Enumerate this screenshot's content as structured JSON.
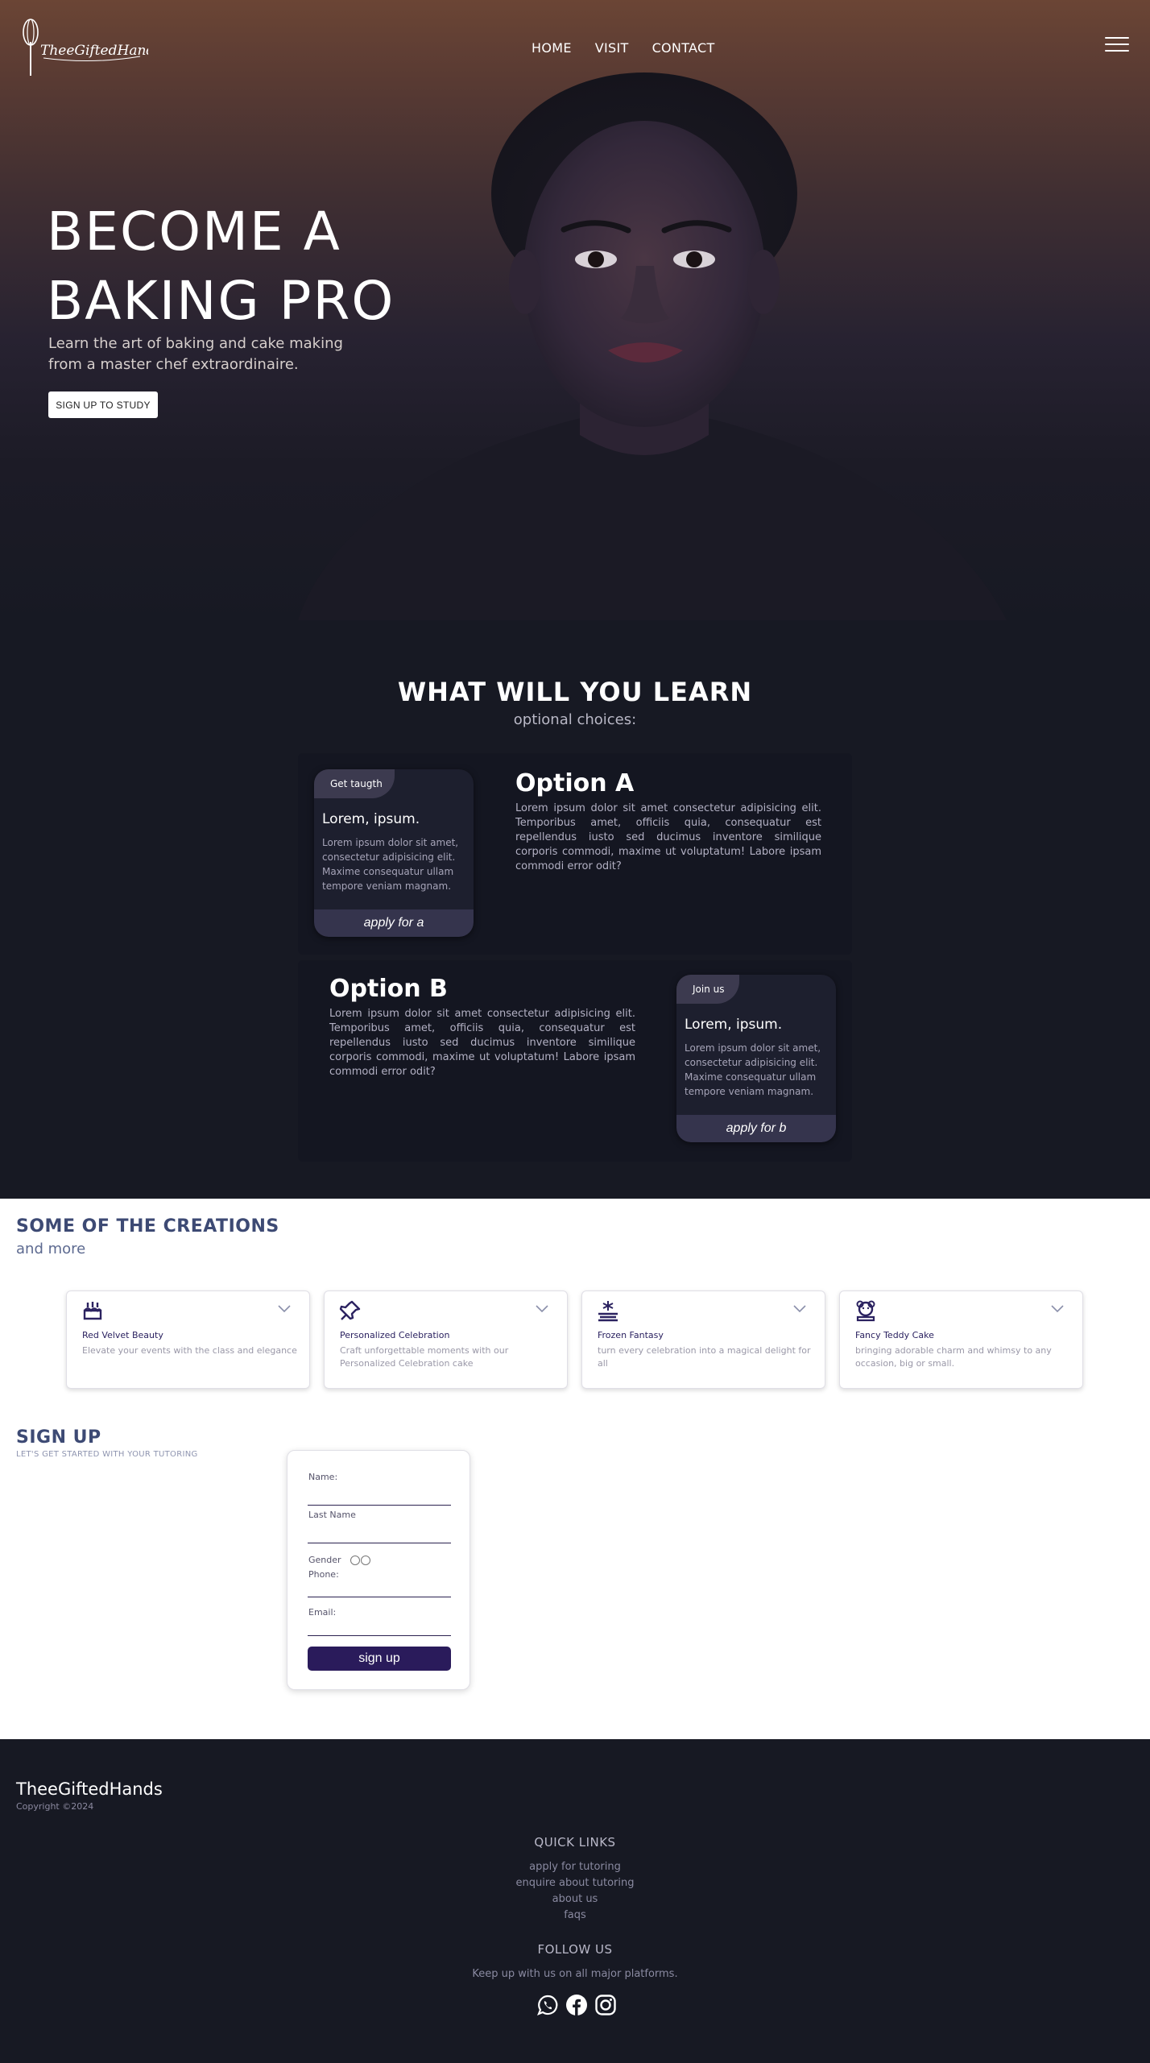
{
  "nav": {
    "logo_text": "TheeGiftedHands",
    "links": [
      "HOME",
      "VISIT",
      "CONTACT"
    ]
  },
  "hero": {
    "title_line1": "BECOME A",
    "title_line2": "BAKING PRO",
    "subtitle": "Learn the art of baking and cake making from a master chef extraordinaire.",
    "cta": "SIGN UP TO STUDY"
  },
  "learn": {
    "title": "WHAT WILL YOU LEARN",
    "subtitle": "optional choices:",
    "options": [
      {
        "card_tag": "Get taugth",
        "card_title": "Lorem, ipsum.",
        "card_text": "Lorem ipsum dolor sit amet, consectetur adipisicing elit. Maxime consequatur ullam tempore veniam magnam.",
        "card_button": "apply for a",
        "heading": "Option A",
        "text": "Lorem ipsum dolor sit amet consectetur adipisicing elit. Temporibus amet, officiis quia, consequatur est repellendus iusto sed ducimus inventore similique corporis commodi, maxime ut voluptatum! Labore ipsam commodi error odit?"
      },
      {
        "card_tag": "Join us",
        "card_title": "Lorem, ipsum.",
        "card_text": "Lorem ipsum dolor sit amet, consectetur adipisicing elit. Maxime consequatur ullam tempore veniam magnam.",
        "card_button": "apply for b",
        "heading": "Option B",
        "text": "Lorem ipsum dolor sit amet consectetur adipisicing elit. Temporibus amet, officiis quia, consequatur est repellendus iusto sed ducimus inventore similique corporis commodi, maxime ut voluptatum! Labore ipsam commodi error odit?"
      }
    ]
  },
  "creations": {
    "title": "SOME OF THE CREATIONS",
    "subtitle": "and more",
    "accent": "#2b2260",
    "items": [
      {
        "icon": "cake-icon",
        "name": "Red Velvet Beauty",
        "desc": "Elevate your events with the class and elegance"
      },
      {
        "icon": "pin-icon",
        "name": "Personalized Celebration",
        "desc": "Craft unforgettable moments with our Personalized Celebration cake"
      },
      {
        "icon": "snowflake-icon",
        "name": "Frozen Fantasy",
        "desc": "turn every celebration into a magical delight for all"
      },
      {
        "icon": "teddy-icon",
        "name": "Fancy Teddy Cake",
        "desc": "bringing adorable charm and whimsy to any occasion, big or small."
      }
    ]
  },
  "signup": {
    "title": "SIGN UP",
    "subtitle": "LET'S GET STARTED WITH YOUR TUTORING",
    "name_label": "Name:",
    "lastname_label": "Last Name",
    "gender_label": "Gender",
    "phone_label": "Phone:",
    "email_label": "Email:",
    "button": "sign up",
    "button_color": "#2a1b5b"
  },
  "footer": {
    "brand": "TheeGiftedHands",
    "copyright": "Copyright ©2024",
    "quick_links_title": "QUICK LINKS",
    "quick_links": [
      "apply for tutoring",
      "enquire about tutoring",
      "about us",
      "faqs"
    ],
    "follow_title": "FOLLOW US",
    "follow_text": "Keep up with us on all major platforms.",
    "socials": [
      "whatsapp-icon",
      "facebook-icon",
      "instagram-icon"
    ]
  }
}
